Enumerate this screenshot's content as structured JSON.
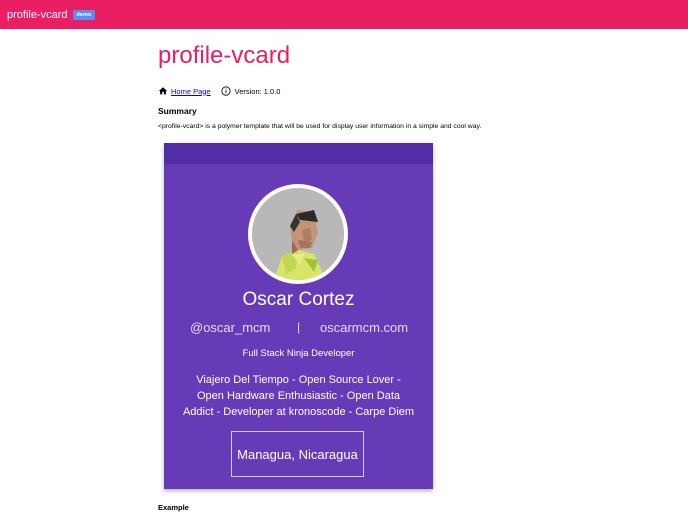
{
  "app": {
    "title": "profile-vcard",
    "badge": "demo"
  },
  "page": {
    "title": "profile-vcard",
    "home_link": "Home Page",
    "version": "Version: 1.0.0",
    "summary_heading": "Summary",
    "summary_text": "<profile-vcard> is a polymer template that will be used for display user information in a simple and cool way.",
    "example_heading": "Example"
  },
  "card": {
    "name": "Oscar Cortez",
    "handle": "@oscar_mcm",
    "separator": "|",
    "website": "oscarmcm.com",
    "role": "Full Stack Ninja Developer",
    "bio": "Viajero Del Tiempo - Open Source Lover - Open Hardware Enthusiastic - Open Data Addict - Developer at kronoscode - Carpe Diem",
    "location": "Managua, Nicaragua"
  },
  "colors": {
    "topbar": "#e91e63",
    "card": "#673ab7",
    "card_header": "#512da8",
    "badge": "#5c8ef2"
  },
  "icons": {
    "home": "home-icon",
    "info": "info-icon"
  }
}
